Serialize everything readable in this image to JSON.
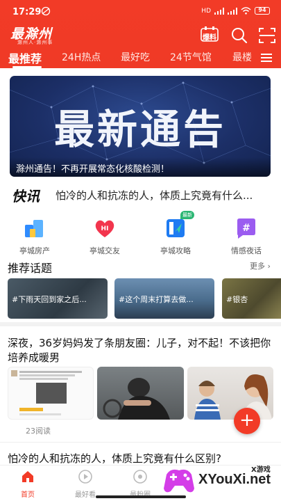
{
  "status_bar": {
    "time": "17:29",
    "battery": "94",
    "net_label": "HD"
  },
  "app": {
    "logo": "最滁州",
    "logo_sub": "滁州人·滁州事",
    "baoliao_label": "爆料"
  },
  "tabs": [
    {
      "label": "最推荐",
      "active": true
    },
    {
      "label": "24H热点"
    },
    {
      "label": "最好吃"
    },
    {
      "label": "24节气馆"
    },
    {
      "label": "最楼"
    }
  ],
  "banner": {
    "title": "最新通告",
    "caption": "滁州通告！不再开展常态化核酸检测！"
  },
  "flash": {
    "logo": "快讯",
    "text": "怕冷的人和抗冻的人，体质上究竟有什么..."
  },
  "grid": [
    {
      "label": "亭城房产",
      "icon": "house-icon"
    },
    {
      "label": "亭城交友",
      "icon": "heart-chat-icon"
    },
    {
      "label": "亭城攻略",
      "icon": "guide-icon",
      "badge": "最新"
    },
    {
      "label": "情感夜话",
      "icon": "hashtag-bubble-icon"
    }
  ],
  "topics": {
    "title": "推荐话题",
    "more": "更多",
    "items": [
      {
        "label": "#下雨天回到家之后..."
      },
      {
        "label": "#这个周末打算去做..."
      },
      {
        "label": "#银杏"
      }
    ]
  },
  "article": {
    "title": "深夜，36岁妈妈发了条朋友圈：儿子，对不起！不该把你培养成暖男",
    "read_count": "23阅读",
    "fab": "+"
  },
  "article2": {
    "title": "怕冷的人和抗冻的人，体质上究竟有什么区别?"
  },
  "bottom_nav": [
    {
      "label": "首页",
      "active": true,
      "icon": "home-icon"
    },
    {
      "label": "最好看",
      "icon": "play-icon"
    },
    {
      "label": "最粉圈",
      "icon": "circle-icon"
    }
  ],
  "watermark": {
    "text": "XYouXi.net",
    "small": "X游戏"
  },
  "colors": {
    "brand_red": "#f23b27",
    "banner_blue": "#1c2f67"
  }
}
